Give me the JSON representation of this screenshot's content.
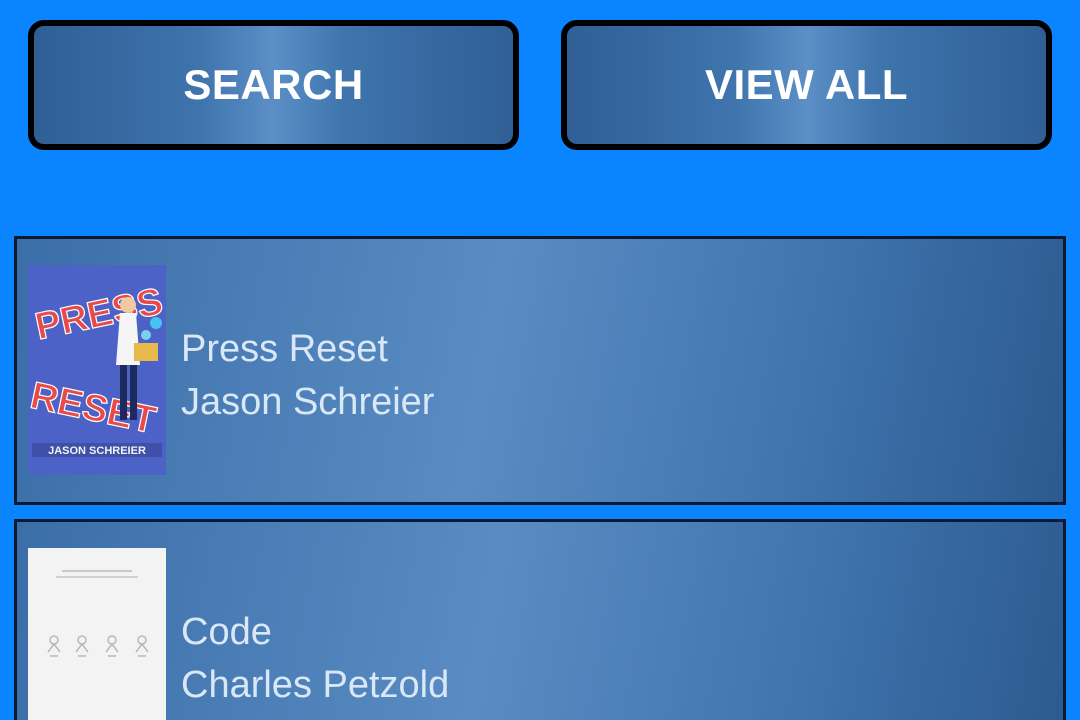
{
  "toolbar": {
    "search_label": "SEARCH",
    "view_all_label": "VIEW ALL"
  },
  "books": [
    {
      "title": "Press Reset",
      "author": "Jason Schreier",
      "cover": {
        "word_top": "PRESS",
        "word_bottom": "RESET",
        "author_line": "JASON SCHREIER"
      }
    },
    {
      "title": "Code",
      "author": "Charles Petzold"
    }
  ],
  "colors": {
    "background": "#0a84ff",
    "button_border": "#000000",
    "button_text": "#ffffff",
    "row_text": "#d9e7f7"
  }
}
